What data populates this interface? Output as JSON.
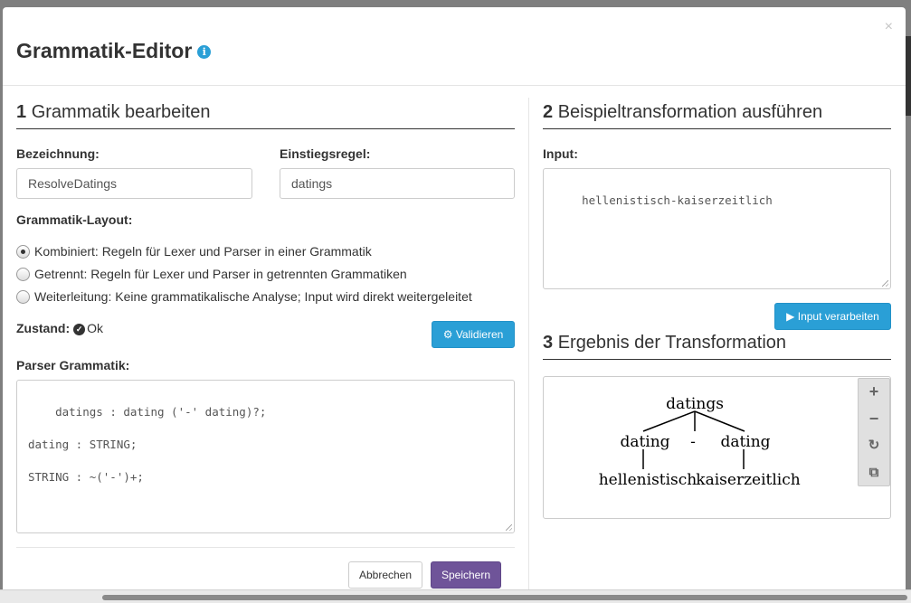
{
  "modal": {
    "title": "Grammatik-Editor",
    "info_icon": "i",
    "close_symbol": "×"
  },
  "section1": {
    "number": "1",
    "title": "Grammatik bearbeiten",
    "bezeichnung_label": "Bezeichnung:",
    "bezeichnung_value": "ResolveDatings",
    "einstiegsregel_label": "Einstiegsregel:",
    "einstiegsregel_value": "datings",
    "layout_label": "Grammatik-Layout:",
    "layout_options": [
      {
        "label": "Kombiniert: Regeln für Lexer und Parser in einer Grammatik",
        "checked": true
      },
      {
        "label": "Getrennt: Regeln für Lexer und Parser in getrennten Grammatiken",
        "checked": false
      },
      {
        "label": "Weiterleitung: Keine grammatikalische Analyse; Input wird direkt weitergeleitet",
        "checked": false
      }
    ],
    "zustand_label": "Zustand:",
    "zustand_value": "Ok",
    "validate_label": "Validieren",
    "parser_label": "Parser Grammatik:",
    "parser_grammar": "datings : dating ('-' dating)?;\n\ndating : STRING;\n\nSTRING : ~('-')+;"
  },
  "footer": {
    "cancel_label": "Abbrechen",
    "save_label": "Speichern"
  },
  "section2": {
    "number": "2",
    "title": "Beispieltransformation ausführen",
    "input_label": "Input:",
    "input_value": "hellenistisch-kaiserzeitlich",
    "process_label": "Input verarbeiten"
  },
  "section3": {
    "number": "3",
    "title": "Ergebnis der Transformation",
    "tree": {
      "root": "datings",
      "child1": "dating",
      "separator": "-",
      "child2": "dating",
      "leaf1": "hellenistisch",
      "leaf2": "kaiserzeitlich"
    },
    "toolbar": {
      "zoom_in": "plus-icon",
      "zoom_out": "minus-icon",
      "reset": "refresh-icon",
      "export": "external-link-icon"
    }
  }
}
